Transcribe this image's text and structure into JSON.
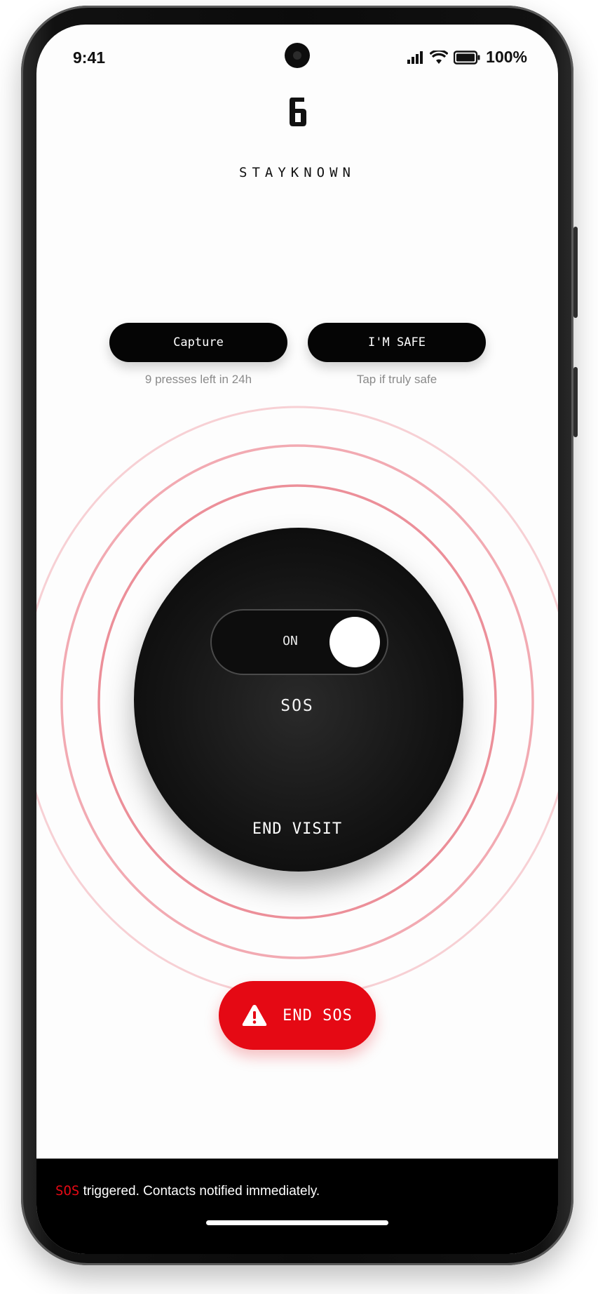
{
  "status_bar": {
    "time": "9:41",
    "battery": "100%",
    "icons": [
      "signal-icon",
      "wifi-icon",
      "battery-icon"
    ]
  },
  "brand": {
    "logo_icon": "six-logo-icon",
    "name": "STAYKNOWN"
  },
  "actions": {
    "capture_label": "Capture",
    "capture_caption": "9 presses left in 24h",
    "safe_label": "I'M SAFE",
    "safe_caption": "Tap if truly safe"
  },
  "dial": {
    "toggle_label": "ON",
    "toggle_on": true,
    "mode_label": "SOS",
    "end_visit_label": "END VISIT"
  },
  "end_sos": {
    "icon": "warning-icon",
    "label": "END SOS"
  },
  "toast": {
    "highlight": "SOS",
    "message": " triggered. Contacts notified immediately."
  },
  "colors": {
    "accent": "#e50914",
    "dark": "#050505",
    "ring": "#f0a0a8"
  }
}
